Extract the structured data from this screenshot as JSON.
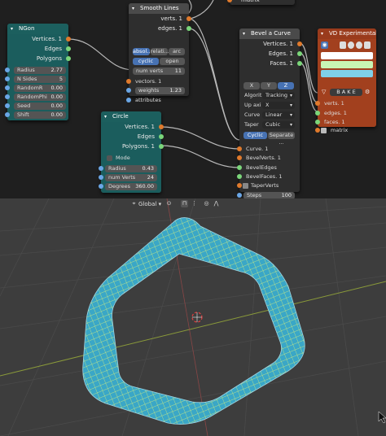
{
  "colors": {
    "node_teal": "#1b5d5d",
    "node_red": "#a2401e",
    "socket_orange": "#e07a2c",
    "socket_green": "#7bd67a",
    "mesh_fill": "#3aa7c7",
    "mesh_wire": "#d8f07a"
  },
  "top_node": {
    "title": "matrix"
  },
  "ngon": {
    "title": "NGon",
    "outputs": [
      "Vertices. 1",
      "Edges",
      "Polygons"
    ],
    "fields": [
      {
        "label": "Radius",
        "value": "2.77"
      },
      {
        "label": "N Sides",
        "value": "5"
      },
      {
        "label": "RandomR",
        "value": "0.00"
      },
      {
        "label": "RandomPhi",
        "value": "0.00"
      },
      {
        "label": "Seed",
        "value": "0.00"
      },
      {
        "label": "Shift",
        "value": "0.00"
      }
    ]
  },
  "smooth": {
    "title": "Smooth Lines",
    "outputs": [
      "verts. 1",
      "edges. 1"
    ],
    "mode_buttons": [
      "absol...",
      "relati...",
      "arc"
    ],
    "cyclic_buttons": [
      "cyclic",
      "open"
    ],
    "num_verts": {
      "label": "num verts",
      "value": "11"
    },
    "inputs": [
      "vectors. 1",
      "weights",
      "attributes"
    ],
    "weights_value": "1.23"
  },
  "circle": {
    "title": "Circle",
    "outputs": [
      "Vertices. 1",
      "Edges",
      "Polygons. 1"
    ],
    "mode_label": "Mode",
    "fields": [
      {
        "label": "Radius",
        "value": "0.43"
      },
      {
        "label": "num Verts",
        "value": "24"
      },
      {
        "label": "Degrees",
        "value": "360.00"
      }
    ]
  },
  "bevel": {
    "title": "Bevel a Curve",
    "outputs": [
      "Vertices. 1",
      "Edges. 1",
      "Faces. 1"
    ],
    "axis_buttons": [
      "X",
      "Y",
      "Z"
    ],
    "settings": [
      {
        "label": "Algorit",
        "value": "Tracking"
      },
      {
        "label": "Up axi",
        "value": "X"
      },
      {
        "label": "Curve",
        "value": "Linear"
      },
      {
        "label": "Taper",
        "value": "Cubic"
      }
    ],
    "cyclic_buttons": [
      "Cyclic",
      "Separate ..."
    ],
    "inputs": [
      "Curve. 1",
      "BevelVerts. 1",
      "BevelEdges",
      "BevelFaces. 1",
      "TaperVerts"
    ],
    "steps": {
      "label": "Steps",
      "value": "100"
    }
  },
  "vd": {
    "title": "VD Experimental",
    "bake_label": "B A K E",
    "inputs": [
      "verts. 1",
      "edges. 1",
      "faces. 1",
      "matrix"
    ]
  },
  "viewport": {
    "orientation": "Global"
  }
}
